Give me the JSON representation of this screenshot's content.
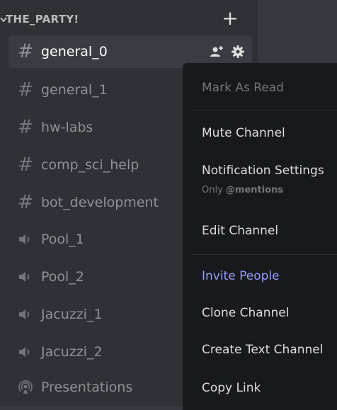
{
  "colors": {
    "sidebar_bg": "#2f3136",
    "active_channel_bg": "#393c43",
    "menu_bg": "#18191c",
    "accent": "#949cf7",
    "muted_text": "#8e9297"
  },
  "category": {
    "name": "THE_PARTY!",
    "chevron_icon": "chevron-down-icon",
    "add_icon": "plus-icon"
  },
  "channels": [
    {
      "name": "general_0",
      "type": "text",
      "icon": "hash-icon",
      "active": true
    },
    {
      "name": "general_1",
      "type": "text",
      "icon": "hash-icon"
    },
    {
      "name": "hw-labs",
      "type": "text",
      "icon": "hash-icon"
    },
    {
      "name": "comp_sci_help",
      "type": "text",
      "icon": "hash-icon"
    },
    {
      "name": "bot_development",
      "type": "text",
      "icon": "hash-icon"
    },
    {
      "name": "Pool_1",
      "type": "voice",
      "icon": "speaker-icon"
    },
    {
      "name": "Pool_2",
      "type": "voice",
      "icon": "speaker-icon"
    },
    {
      "name": "Jacuzzi_1",
      "type": "voice",
      "icon": "speaker-icon"
    },
    {
      "name": "Jacuzzi_2",
      "type": "voice",
      "icon": "speaker-icon"
    },
    {
      "name": "Presentations",
      "type": "stage",
      "icon": "stage-icon"
    }
  ],
  "channel_actions": {
    "invite_icon": "add-member-icon",
    "settings_icon": "gear-icon"
  },
  "context_menu": {
    "mark_as_read": "Mark As Read",
    "mute_channel": "Mute Channel",
    "notification_settings": "Notification Settings",
    "notification_sub_prefix": "Only ",
    "notification_sub_value": "@mentions",
    "edit_channel": "Edit Channel",
    "invite_people": "Invite People",
    "clone_channel": "Clone Channel",
    "create_text_channel": "Create Text Channel",
    "copy_link": "Copy Link"
  }
}
